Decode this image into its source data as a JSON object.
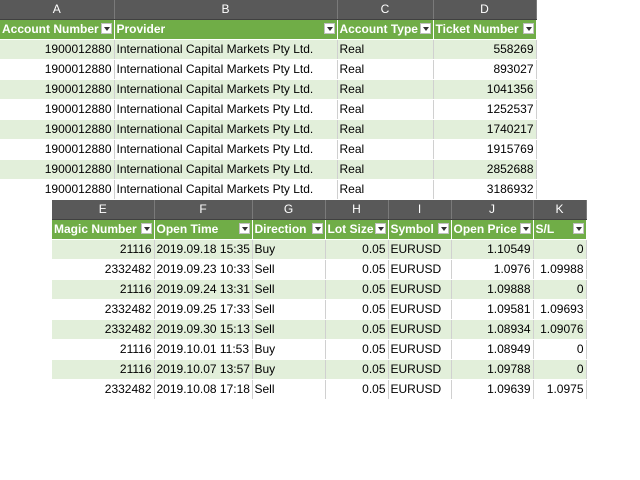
{
  "table1": {
    "column_letters": [
      "A",
      "B",
      "C",
      "D"
    ],
    "headers": [
      "Account Number",
      "Provider",
      "Account Type",
      "Ticket Number"
    ],
    "rows": [
      [
        "1900012880",
        "International Capital Markets Pty Ltd.",
        "Real",
        "558269"
      ],
      [
        "1900012880",
        "International Capital Markets Pty Ltd.",
        "Real",
        "893027"
      ],
      [
        "1900012880",
        "International Capital Markets Pty Ltd.",
        "Real",
        "1041356"
      ],
      [
        "1900012880",
        "International Capital Markets Pty Ltd.",
        "Real",
        "1252537"
      ],
      [
        "1900012880",
        "International Capital Markets Pty Ltd.",
        "Real",
        "1740217"
      ],
      [
        "1900012880",
        "International Capital Markets Pty Ltd.",
        "Real",
        "1915769"
      ],
      [
        "1900012880",
        "International Capital Markets Pty Ltd.",
        "Real",
        "2852688"
      ],
      [
        "1900012880",
        "International Capital Markets Pty Ltd.",
        "Real",
        "3186932"
      ]
    ]
  },
  "table2": {
    "column_letters": [
      "E",
      "F",
      "G",
      "H",
      "I",
      "J",
      "K"
    ],
    "headers": [
      "Magic Number",
      "Open Time",
      "Direction",
      "Lot Size",
      "Symbol",
      "Open Price",
      "S/L"
    ],
    "rows": [
      [
        "21116",
        "2019.09.18 15:35",
        "Buy",
        "0.05",
        "EURUSD",
        "1.10549",
        "0"
      ],
      [
        "2332482",
        "2019.09.23 10:33",
        "Sell",
        "0.05",
        "EURUSD",
        "1.0976",
        "1.09988"
      ],
      [
        "21116",
        "2019.09.24 13:31",
        "Sell",
        "0.05",
        "EURUSD",
        "1.09888",
        "0"
      ],
      [
        "2332482",
        "2019.09.25 17:33",
        "Sell",
        "0.05",
        "EURUSD",
        "1.09581",
        "1.09693"
      ],
      [
        "2332482",
        "2019.09.30 15:13",
        "Sell",
        "0.05",
        "EURUSD",
        "1.08934",
        "1.09076"
      ],
      [
        "21116",
        "2019.10.01 11:53",
        "Buy",
        "0.05",
        "EURUSD",
        "1.08949",
        "0"
      ],
      [
        "21116",
        "2019.10.07 13:57",
        "Buy",
        "0.05",
        "EURUSD",
        "1.09788",
        "0"
      ],
      [
        "2332482",
        "2019.10.08 17:18",
        "Sell",
        "0.05",
        "EURUSD",
        "1.09639",
        "1.0975"
      ]
    ]
  },
  "colors": {
    "header_green": "#70ad47",
    "band_green": "#e2efda",
    "column_letter_bg": "#595959"
  },
  "icons": {
    "filter": "filter-dropdown-icon"
  }
}
